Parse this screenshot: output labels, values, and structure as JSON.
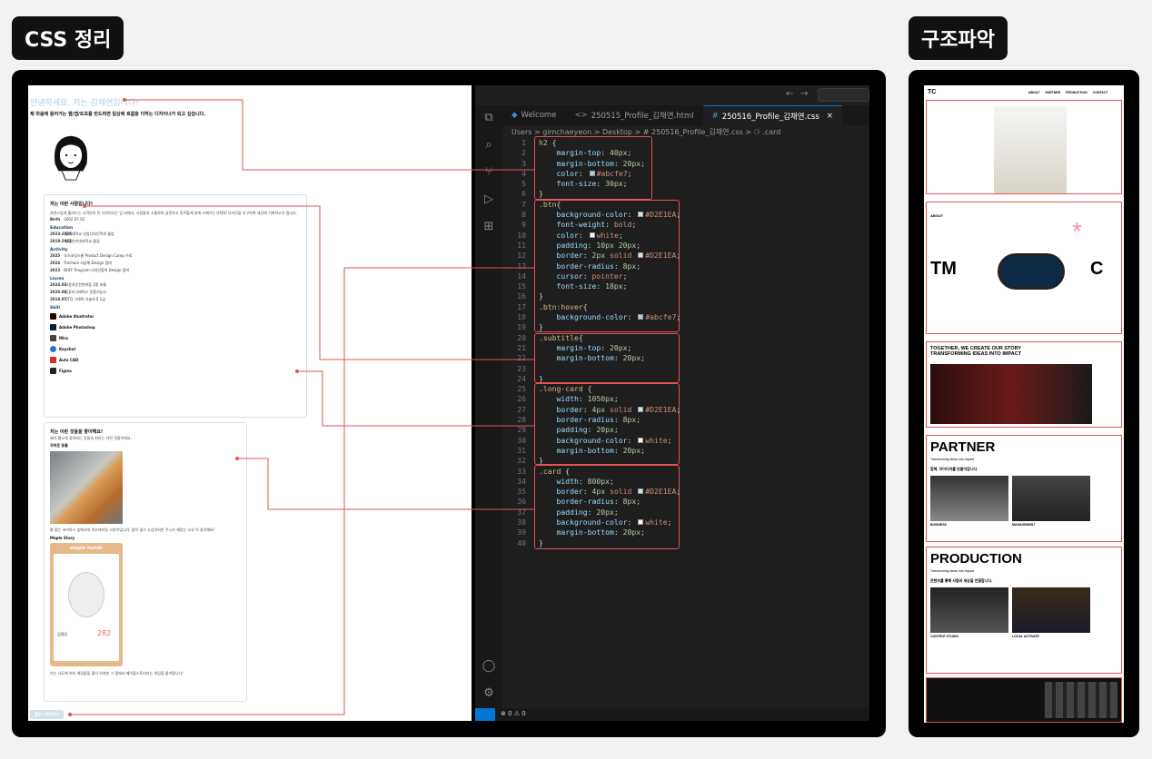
{
  "labels": {
    "left": "CSS 정리",
    "right": "구조파악"
  },
  "preview": {
    "h2": "안녕하세요. 저는 김채연입니다!",
    "intro": "제 마음에 들어가는 웹/앱/트프를 만드려면 일상에 흐름을 더하는 디자이너가 되고 싶습니다.",
    "card1": {
      "title": "저는 이런 사람입니다!",
      "desc": "자연스럽게 흘러드는 사격부터 된 디자이너는 입 되에서, 사람들과 소통하며 글전하고 전르할게 살게 스메가는 UX/UI 디자인을 추구하며 세상에 기여하고가 됩니다.",
      "birth_label": "Birth",
      "birth": "2002.07.02",
      "education_label": "Education",
      "education": [
        [
          "2023-2025",
          "동의대학교 산업디자인학과 졸업"
        ],
        [
          "2018-2021",
          "부경인터넷과학교 졸업"
        ]
      ],
      "activity_label": "Activity",
      "activity": [
        [
          "2025",
          "오즈코딩스쿨 Product Design Camp 수료"
        ],
        [
          "2024",
          "Trechola 서남해 Design 참여"
        ],
        [
          "2023",
          "BUFF Program 디자인참여 Design 참여"
        ]
      ],
      "license_label": "Lisces",
      "license": [
        [
          "2024.03",
          "자동차운전면허증 2종 보통"
        ],
        [
          "2020.06",
          "컴퓨터그래픽스 운용기능사"
        ],
        [
          "2018.07",
          "GTQ 그래픽 기술자격 1급"
        ]
      ],
      "skill_label": "Skill",
      "skills": [
        "Adobe Illustrator",
        "Adobe Photoshop",
        "Miro",
        "Keyshot",
        "Auto CAD",
        "Figma"
      ]
    },
    "card2": {
      "title": "저는 이런 것들을 좋아해요!",
      "desc": "제가 평소에 좋아하는 것들과 취미는 이런 것들이에요.",
      "cat_label": "귀여운 동물",
      "cat_desc": "평 좋는 코리아시 숨에서의 치즈케이킹 고양이입니다. 많이 많고 소심하지만 꾸시가 재밌는 소유 이 좋아해요!",
      "game_label": "Maple Story",
      "game_card_title": "maple hands",
      "game_name": "김쟁잉",
      "game_level": "282",
      "game_desc": "어는 너도에 여러 게임들을 많이 하지만 그 중에서 메이플스토리라는 게임을 즐겨합니다!"
    },
    "button": "블로그 확인하기"
  },
  "vscode": {
    "tabs": [
      "Welcome",
      "250515_Profile_김채연.html",
      "250516_Profile_김채연.css"
    ],
    "breadcrumb": "Users > gimchaeyeon > Desktop > # 250516_Profile_김채연.css > ⚆ .card",
    "status": "⊗ 0 ⚠ 0",
    "code": [
      "h2 {",
      "    margin-top: 40px;",
      "    margin-bottom: 20px;",
      "    color: #abcfe7;",
      "    font-size: 30px;",
      "}",
      ".btn{",
      "    background-color: #D2E1EA;",
      "    font-weight: bold;",
      "    color:white;",
      "    padding: 10px 20px;",
      "    border: 2px solid #D2E1EA;",
      "    border-radius: 8px;",
      "    cursor: pointer;",
      "    font-size: 18px;",
      "}",
      ".btn:hover{",
      "    background-color: #abcfe7;",
      "}",
      ".subtitle{",
      "    margin-top: 20px;",
      "    margin-bottom: 20px;",
      "",
      "}",
      ".long-card {",
      "    width: 1050px;",
      "    border: 4px solid #D2E1EA;",
      "    border-radius: 8px;",
      "    padding: 20px;",
      "    background-color: white;",
      "    margin-bottom: 20px;",
      "}",
      ".card {",
      "    width: 800px;",
      "    border: 4px solid #D2E1EA;",
      "    border-radius: 8px;",
      "    padding: 20px;",
      "    background-color: white;",
      "    margin-bottom: 20px;",
      "}"
    ]
  },
  "site": {
    "logo": "TC",
    "nav": [
      "ABOUT",
      "PARTNER",
      "PRODUCTION",
      "CONTACT"
    ],
    "about": "ABOUT",
    "tm_left": "TM",
    "tm_right": "C",
    "together": "TOGETHER, WE CREATE OUR STORY\nTRANSFORMING IDEAS INTO IMPACT",
    "partner": "PARTNER",
    "partner_sub": "Transforming Ideas into Impact",
    "partner_kr": "함께, 아이디어를 만들어갑니다.",
    "business": "BUSINESS",
    "management": "MANAGEMENT",
    "production": "PRODUCTION",
    "production_sub": "Transforming Ideas into Impact",
    "production_kr": "콘텐츠를 통해 사람과 세상을 연결합니다.",
    "content_studio": "CONTENT STUDIO",
    "local_activate": "LOCAL ACTIVATE"
  },
  "colors": {
    "accent": "#abcfe7",
    "border": "#D2E1EA",
    "annot": "#e05555"
  }
}
